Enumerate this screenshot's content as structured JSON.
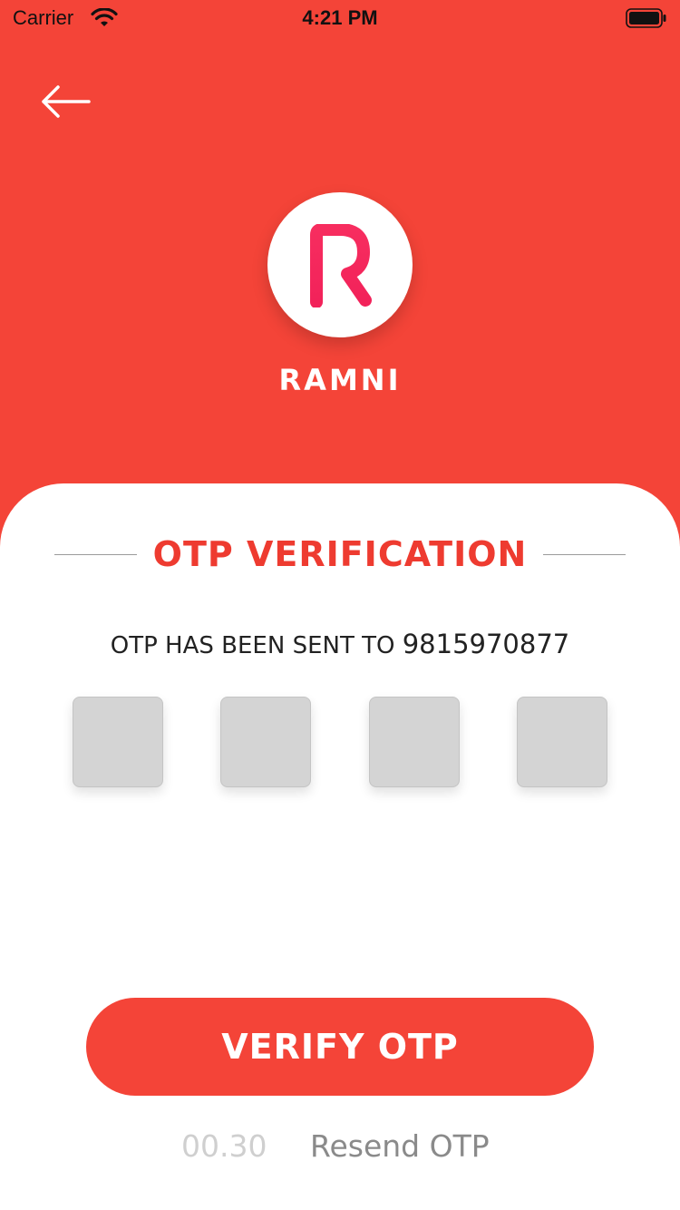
{
  "status_bar": {
    "carrier": "Carrier",
    "time": "4:21 PM"
  },
  "header": {
    "back_icon": "arrow-left-icon",
    "logo_letter": "R",
    "brand_name": "RAMNI"
  },
  "card": {
    "title": "OTP VERIFICATION",
    "sent_label": "OTP HAS BEEN SENT TO",
    "phone_number": "9815970877",
    "otp_boxes": [
      "",
      "",
      "",
      ""
    ],
    "verify_button": "VERIFY OTP",
    "timer": "00.30",
    "resend_label": "Resend OTP"
  },
  "colors": {
    "brand_red": "#f44438",
    "title_red": "#ee3b30",
    "logo_pink": "#f72d5f"
  }
}
